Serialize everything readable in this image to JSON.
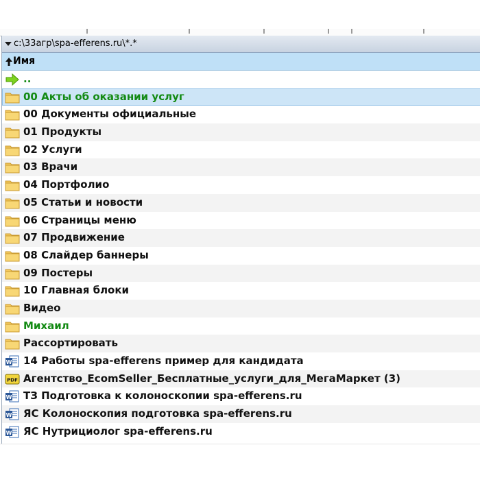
{
  "pathbar": {
    "path": "c:\\33агр\\spa-efferens.ru\\*.*"
  },
  "columns": {
    "name": "Имя"
  },
  "rows": [
    {
      "label": "..",
      "icon": "up-arrow-icon",
      "color": "#138a13"
    },
    {
      "label": "00 Акты об оказании услуг",
      "icon": "folder-icon",
      "selected": true,
      "color": "#138a13"
    },
    {
      "label": "00 Документы официальные",
      "icon": "folder-icon"
    },
    {
      "label": "01 Продукты",
      "icon": "folder-icon"
    },
    {
      "label": "02 Услуги",
      "icon": "folder-icon"
    },
    {
      "label": "03 Врачи",
      "icon": "folder-icon"
    },
    {
      "label": "04 Портфолио",
      "icon": "folder-icon"
    },
    {
      "label": "05 Статьи и новости",
      "icon": "folder-icon"
    },
    {
      "label": "06 Страницы меню",
      "icon": "folder-icon"
    },
    {
      "label": "07 Продвижение",
      "icon": "folder-icon"
    },
    {
      "label": "08 Слайдер баннеры",
      "icon": "folder-icon"
    },
    {
      "label": "09 Постеры",
      "icon": "folder-icon"
    },
    {
      "label": "10 Главная блоки",
      "icon": "folder-icon"
    },
    {
      "label": "Видео",
      "icon": "folder-icon"
    },
    {
      "label": "Михаил",
      "icon": "folder-icon",
      "color": "#138a13"
    },
    {
      "label": "Рассортировать",
      "icon": "folder-icon"
    },
    {
      "label": "14 Работы spa-efferens пример для кандидата",
      "icon": "word-doc-icon"
    },
    {
      "label": "Агентство_EcomSeller_Бесплатные_услуги_для_МегаМаркет (3)",
      "icon": "pdf-icon"
    },
    {
      "label": "ТЗ Подготовка к колоноскопии spa-efferens.ru",
      "icon": "word-doc-icon"
    },
    {
      "label": "ЯС Колоноскопия подготовка spa-efferens.ru",
      "icon": "word-doc-icon"
    },
    {
      "label": "ЯС Нутрициолог spa-efferens.ru",
      "icon": "word-doc-icon"
    }
  ],
  "colors": {
    "selection": "#cde5f7",
    "header": "#bfe0f7",
    "green": "#138a13"
  }
}
